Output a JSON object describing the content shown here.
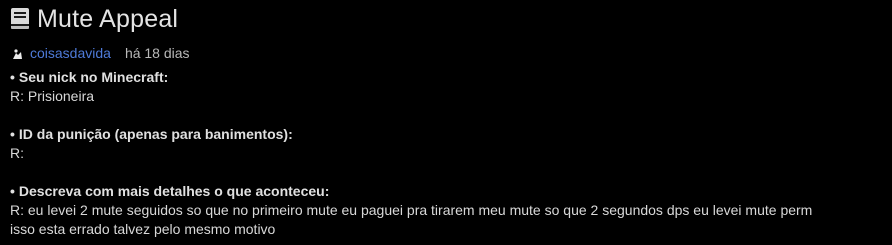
{
  "post": {
    "title": "Mute Appeal",
    "title_icon": "book-icon",
    "author": "coisasdavida",
    "time": "há 18 dias"
  },
  "fields": [
    {
      "bullet": "•",
      "question": "Seu nick no Minecraft:",
      "answer": "R: Prisioneira"
    },
    {
      "bullet": "•",
      "question": "ID da punição (apenas para banimentos):",
      "answer": "R:"
    },
    {
      "bullet": "•",
      "question": "Descreva com mais detalhes o que aconteceu:",
      "answer": "R: eu levei 2 mute seguidos so que no primeiro mute eu paguei pra tirarem meu mute so que 2 segundos dps eu levei mute perm",
      "answer_cont": "isso esta errado talvez pelo mesmo motivo"
    }
  ],
  "colors": {
    "background": "#000000",
    "author_link": "#4e7ad8",
    "text": "#d8d8d8"
  }
}
